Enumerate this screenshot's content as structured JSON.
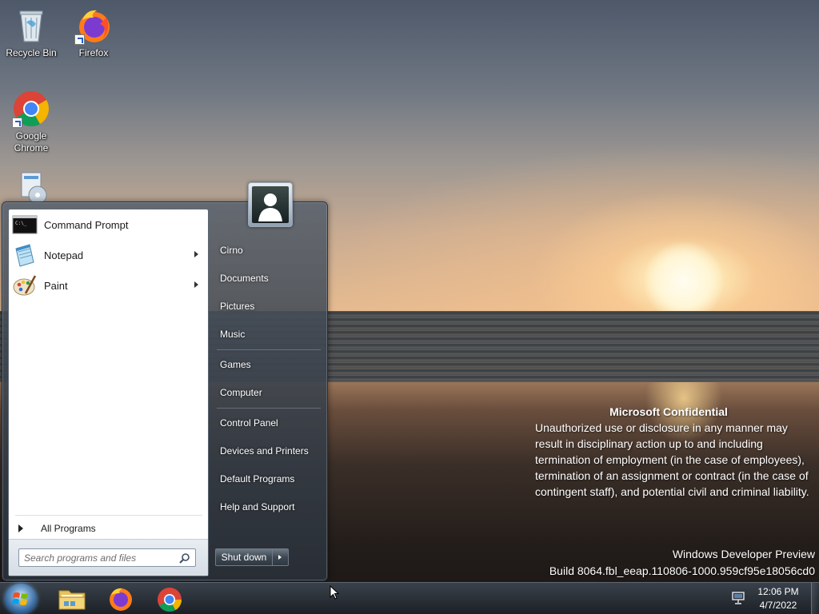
{
  "desktop": {
    "icons": [
      {
        "label": "Recycle Bin",
        "icon": "recycle-bin-icon"
      },
      {
        "label": "Firefox",
        "icon": "firefox-icon"
      },
      {
        "label": "Google Chrome",
        "icon": "chrome-icon"
      },
      {
        "label": "",
        "icon": "installer-icon"
      }
    ]
  },
  "start_menu": {
    "programs": [
      {
        "label": "Command Prompt",
        "icon": "command-prompt-icon",
        "has_submenu": false
      },
      {
        "label": "Notepad",
        "icon": "notepad-icon",
        "has_submenu": true
      },
      {
        "label": "Paint",
        "icon": "paint-icon",
        "has_submenu": true
      }
    ],
    "all_programs_label": "All Programs",
    "search_placeholder": "Search programs and files",
    "right_links": [
      {
        "label": "Cirno"
      },
      {
        "label": "Documents"
      },
      {
        "label": "Pictures"
      },
      {
        "label": "Music"
      },
      {
        "label": "Games"
      },
      {
        "label": "Computer"
      },
      {
        "label": "Control Panel"
      },
      {
        "label": "Devices and Printers"
      },
      {
        "label": "Default Programs"
      },
      {
        "label": "Help and Support"
      }
    ],
    "shutdown_label": "Shut down"
  },
  "watermark": {
    "title": "Microsoft Confidential",
    "body": "Unauthorized use or disclosure in any manner may result in disciplinary action up to and including termination of employment (in the case of employees), termination of an assignment or contract (in the case of contingent staff), and potential civil and criminal liability.",
    "edition": "Windows Developer Preview",
    "build": "Build 8064.fbl_eeap.110806-1000.959cf95e18056cd0"
  },
  "taskbar": {
    "pinned": [
      {
        "icon": "file-explorer-icon"
      },
      {
        "icon": "firefox-icon"
      },
      {
        "icon": "chrome-icon"
      }
    ],
    "tray_icon": "network-icon",
    "clock": {
      "time": "12:06 PM",
      "date": "4/7/2022"
    }
  },
  "colors": {
    "taskbar": "#23282f",
    "start_menu_pane": "#ffffff",
    "right_link_text": "#ffffff"
  }
}
